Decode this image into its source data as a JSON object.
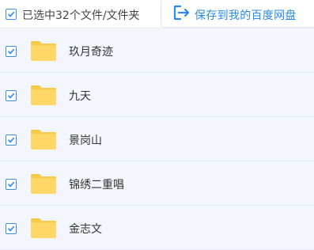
{
  "toolbar": {
    "select_all_label": "已选中32个文件/文件夹",
    "select_all_checked": true,
    "save_button_label": "保存到我的百度网盘"
  },
  "colors": {
    "accent": "#2a8be6",
    "checkbox": "#3b8ff3",
    "folder": "#ffd766",
    "folder_tab": "#f7c94a"
  },
  "files": [
    {
      "name": "玖月奇迹",
      "type": "folder",
      "checked": true
    },
    {
      "name": "九天",
      "type": "folder",
      "checked": true
    },
    {
      "name": "景岗山",
      "type": "folder",
      "checked": true
    },
    {
      "name": "锦绣二重唱",
      "type": "folder",
      "checked": true
    },
    {
      "name": "金志文",
      "type": "folder",
      "checked": true
    }
  ]
}
